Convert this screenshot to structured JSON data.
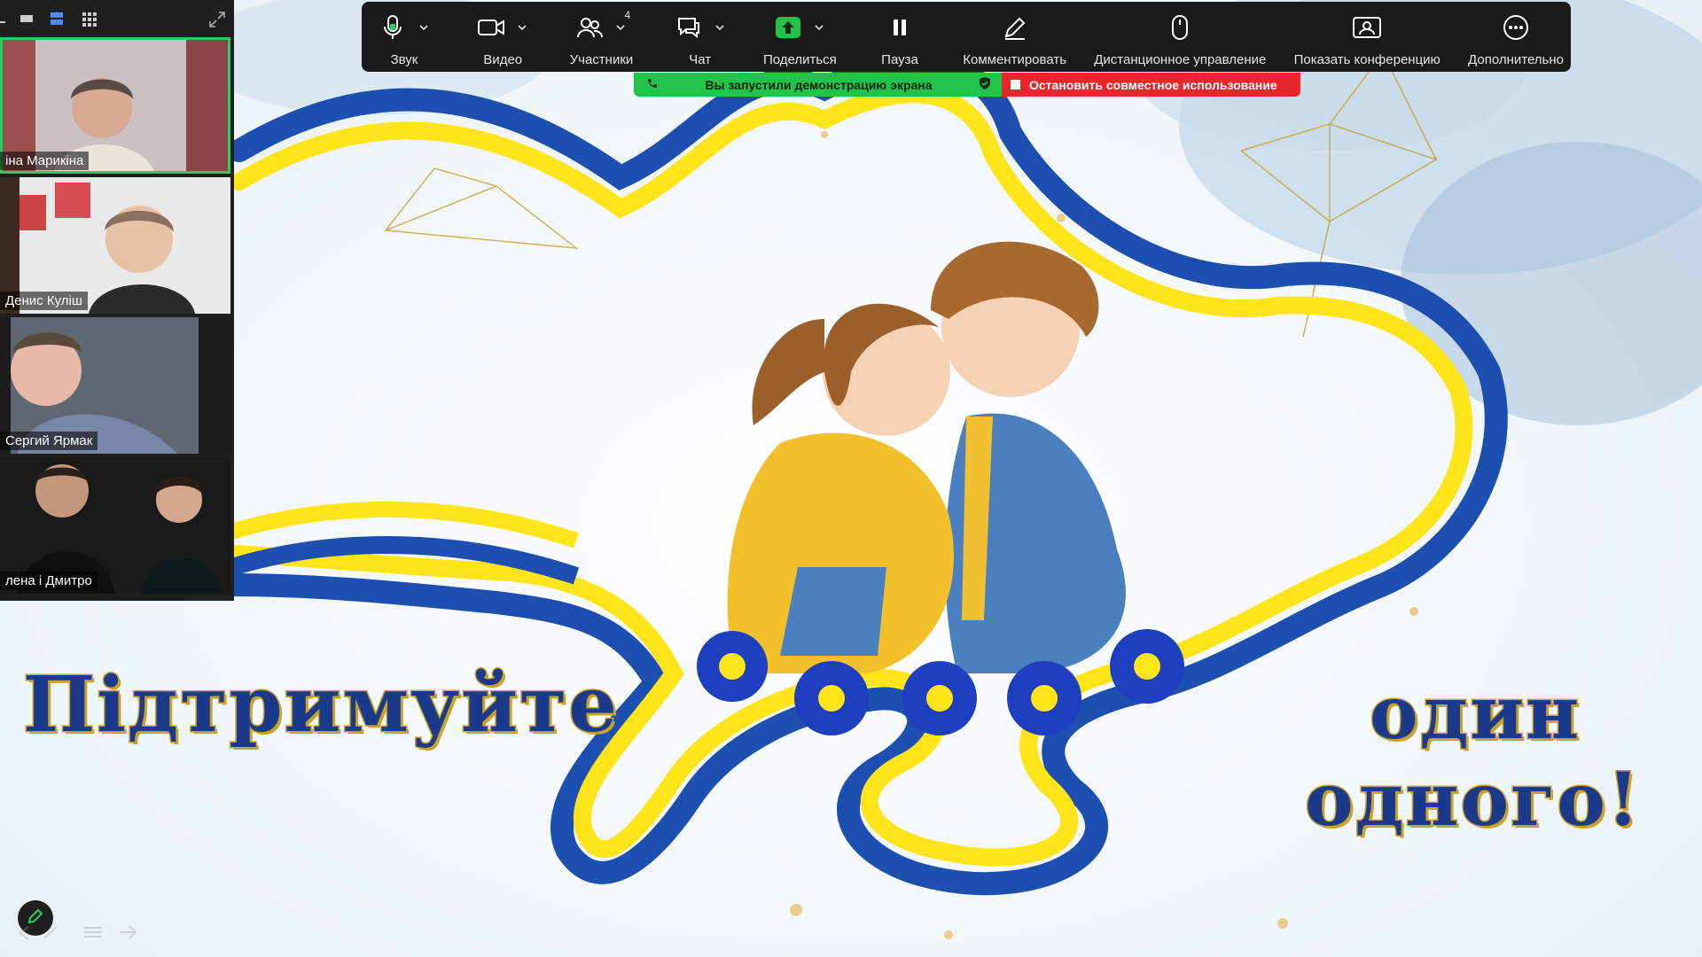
{
  "toolbar": {
    "items": [
      {
        "label": "Звук",
        "icon": "microphone-icon",
        "caret": true
      },
      {
        "label": "Видео",
        "icon": "video-camera-icon",
        "caret": true
      },
      {
        "label": "Участники",
        "icon": "participants-icon",
        "caret": true,
        "badge": "4"
      },
      {
        "label": "Чат",
        "icon": "chat-icon",
        "caret": true
      },
      {
        "label": "Поделиться",
        "icon": "share-screen-icon",
        "caret": true
      },
      {
        "label": "Пауза",
        "icon": "pause-icon",
        "caret": false
      },
      {
        "label": "Комментировать",
        "icon": "annotate-pencil-icon",
        "caret": false
      },
      {
        "label": "Дистанционное управление",
        "icon": "mouse-icon",
        "caret": false
      },
      {
        "label": "Показать конференцию",
        "icon": "show-meeting-icon",
        "caret": false
      },
      {
        "label": "Дополнительно",
        "icon": "more-icon",
        "caret": false
      }
    ],
    "accent_green": "#21c34b"
  },
  "share_banner": {
    "status": "Вы запустили демонстрацию экрана",
    "stop_label": "Остановить совместное использование",
    "green": "#21c34b",
    "red": "#e8262b"
  },
  "video_panel": {
    "participants": [
      {
        "name": "іна Марикіна",
        "active": true
      },
      {
        "name": "Денис Куліш",
        "active": false
      },
      {
        "name": "Сергий Ярмак",
        "active": false
      },
      {
        "name": "лена і Дмитро",
        "active": false
      }
    ]
  },
  "slide": {
    "text_left": "Підтримуйте",
    "text_right_line1": "один",
    "text_right_line2": "одного!",
    "colors": {
      "blue": "#1c3a8c",
      "yellow": "#ffe41a",
      "flag_blue": "#1d4fb0",
      "gold": "#c9a227"
    }
  }
}
